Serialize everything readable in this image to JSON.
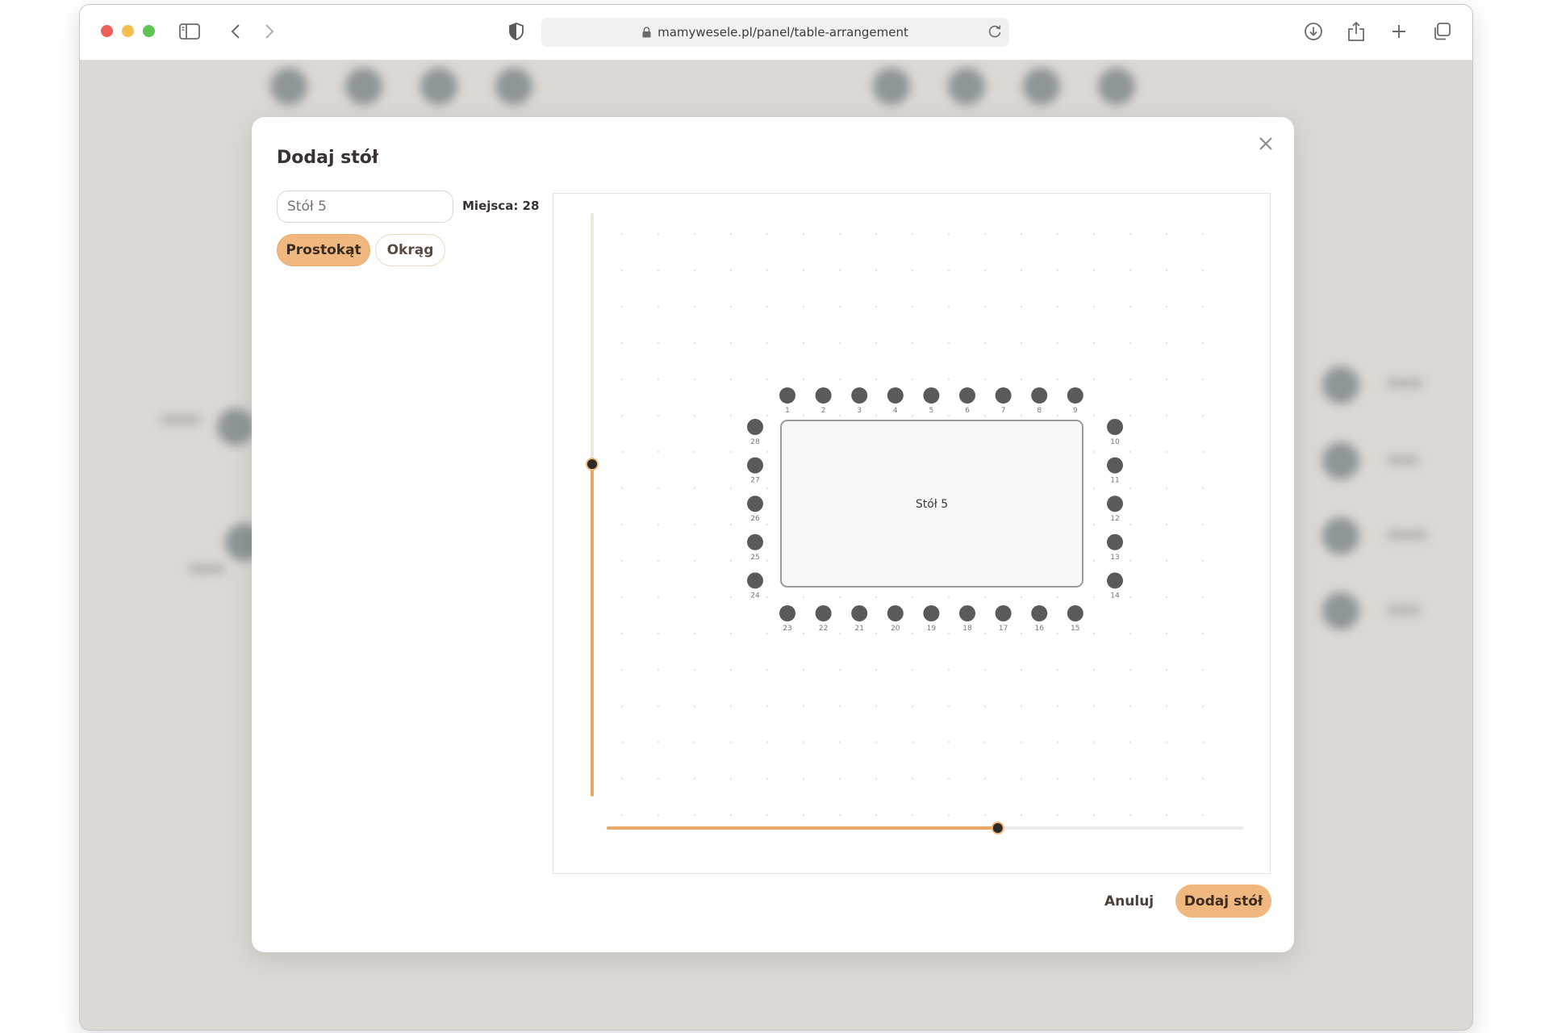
{
  "browser": {
    "url": "mamywesele.pl/panel/table-arrangement"
  },
  "modal": {
    "title": "Dodaj stół",
    "name_value": "Stół 5",
    "seats_label": "Miejsca: 28",
    "shape_rect_label": "Prostokąt",
    "shape_circle_label": "Okrąg",
    "selected_shape": "rectangle",
    "cancel_label": "Anuluj",
    "submit_label": "Dodaj stół"
  },
  "preview": {
    "table_label": "Stół 5",
    "seat_count": 28,
    "seat_numbers_top": [
      "1",
      "2",
      "3",
      "4",
      "5",
      "6",
      "7",
      "8",
      "9"
    ],
    "seat_numbers_right": [
      "10",
      "11",
      "12",
      "13",
      "14"
    ],
    "seat_numbers_bottom": [
      "15",
      "16",
      "17",
      "18",
      "19",
      "20",
      "21",
      "22",
      "23"
    ],
    "seat_numbers_left": [
      "24",
      "25",
      "26",
      "27",
      "28"
    ],
    "width_slider_fraction": 0.615,
    "height_slider_fraction": 0.57
  },
  "colors": {
    "accent": "#f0b77e",
    "slider_track": "#e9a868",
    "seat": "#5a5a5a",
    "slider_thumb": "#2d2a28",
    "overlay": "#dcd8d4"
  },
  "icons": {
    "sidebar": "sidebar-icon",
    "back": "chevron-left-icon",
    "forward": "chevron-right-icon",
    "shield": "shield-icon",
    "lock": "lock-icon",
    "reload": "reload-icon",
    "download": "download-icon",
    "share": "share-icon",
    "new_tab": "plus-icon",
    "tabs": "tabs-icon",
    "close": "close-icon"
  }
}
